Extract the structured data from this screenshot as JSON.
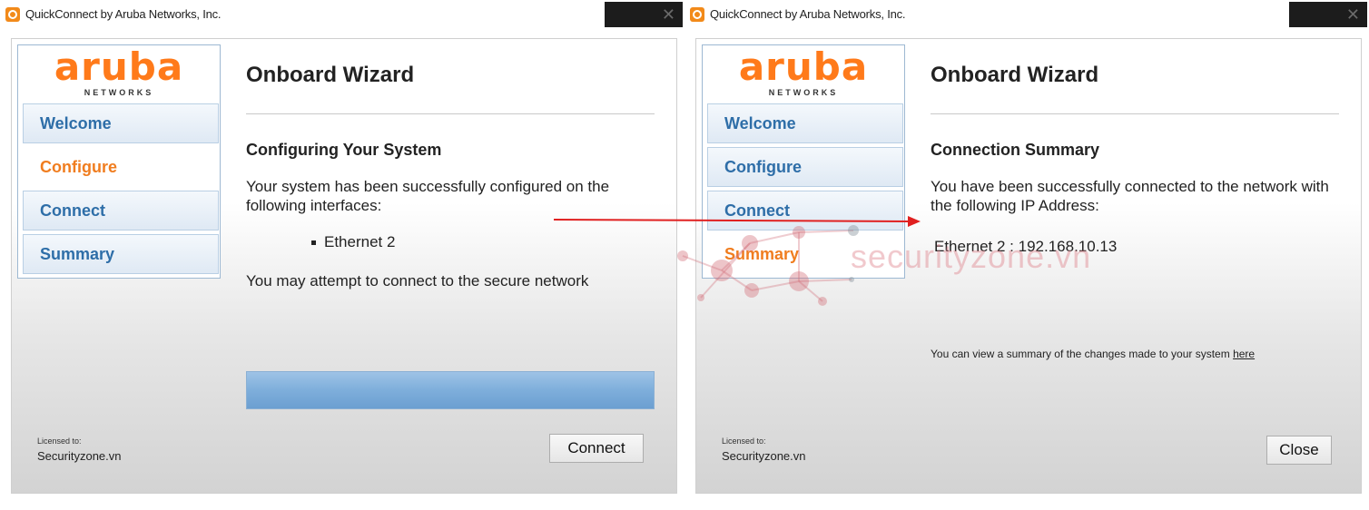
{
  "left": {
    "title": "QuickConnect by Aruba Networks, Inc.",
    "close_glyph": "✕",
    "logo": {
      "word": "aruba",
      "sub": "NETWORKS"
    },
    "nav": [
      "Welcome",
      "Configure",
      "Connect",
      "Summary"
    ],
    "heading": "Onboard Wizard",
    "subheading": "Configuring Your System",
    "body1": "Your system has been successfully configured on the following interfaces:",
    "bullet": "Ethernet 2",
    "body2": "You may attempt to connect to the secure network",
    "progress_fraction": 1.0,
    "licensed_label": "Licensed to:",
    "licensed_name": "Securityzone.vn",
    "button": "Connect"
  },
  "right": {
    "title": "QuickConnect by Aruba Networks, Inc.",
    "close_glyph": "✕",
    "logo": {
      "word": "aruba",
      "sub": "NETWORKS"
    },
    "nav": [
      "Welcome",
      "Configure",
      "Connect",
      "Summary"
    ],
    "heading": "Onboard Wizard",
    "subheading": "Connection Summary",
    "body1": "You have been successfully connected to the network with the following IP Address:",
    "ip_line": "Ethernet 2 : 192.168.10.13",
    "summary_note": "You can view a summary of the changes made to your system",
    "summary_link": "here",
    "licensed_label": "Licensed to:",
    "licensed_name": "Securityzone.vn",
    "button": "Close"
  },
  "watermark": {
    "text": "securityzone.vn"
  },
  "colors": {
    "brand_orange": "#ff7a1a",
    "nav_blue": "#2e6ea8",
    "arrow_red": "#e02020"
  }
}
